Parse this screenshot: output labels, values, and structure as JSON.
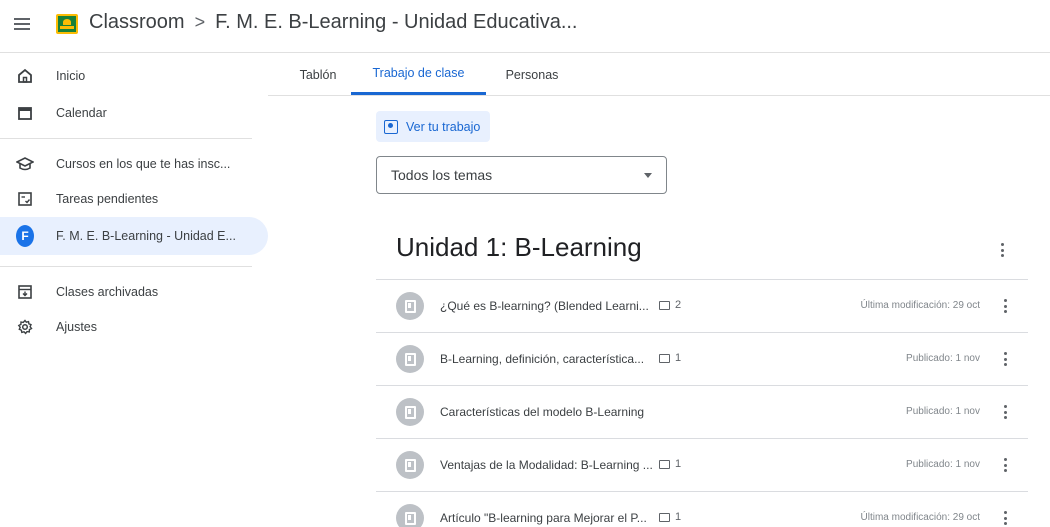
{
  "header": {
    "app_name": "Classroom",
    "separator": ">",
    "course_title": "F. M. E. B-Learning - Unidad Educativa..."
  },
  "sidebar": {
    "items": [
      {
        "label": "Inicio",
        "icon": "home-icon"
      },
      {
        "label": "Calendar",
        "icon": "calendar-icon"
      },
      {
        "label": "Cursos en los que te has insc...",
        "icon": "school-icon"
      },
      {
        "label": "Tareas pendientes",
        "icon": "todo-icon"
      },
      {
        "label": "F. M. E. B-Learning - Unidad E...",
        "icon": "avatar",
        "avatar_letter": "F",
        "active": true
      },
      {
        "label": "Clases archivadas",
        "icon": "archive-icon"
      },
      {
        "label": "Ajustes",
        "icon": "settings-icon"
      }
    ]
  },
  "tabs": [
    {
      "label": "Tablón"
    },
    {
      "label": "Trabajo de clase",
      "active": true
    },
    {
      "label": "Personas"
    }
  ],
  "main": {
    "view_work_label": "Ver tu trabajo",
    "topic_filter": "Todos los temas",
    "topic_title": "Unidad 1: B-Learning",
    "items": [
      {
        "title": "¿Qué es B-learning? (Blended Learni...",
        "comments": "2",
        "date": "Última modificación: 29 oct"
      },
      {
        "title": "B-Learning, definición, característica...",
        "comments": "1",
        "date": "Publicado: 1 nov"
      },
      {
        "title": "Características del modelo B-Learning",
        "comments": "",
        "date": "Publicado: 1 nov"
      },
      {
        "title": "Ventajas de la Modalidad: B-Learning ...",
        "comments": "1",
        "date": "Publicado: 1 nov"
      },
      {
        "title": "Artículo \"B-learning para Mejorar el P...",
        "comments": "1",
        "date": "Última modificación: 29 oct"
      }
    ]
  },
  "colors": {
    "accent": "#1967d2",
    "active_bg": "#e8f0fe",
    "logo_green": "#188038",
    "logo_yellow": "#fbbc04"
  }
}
